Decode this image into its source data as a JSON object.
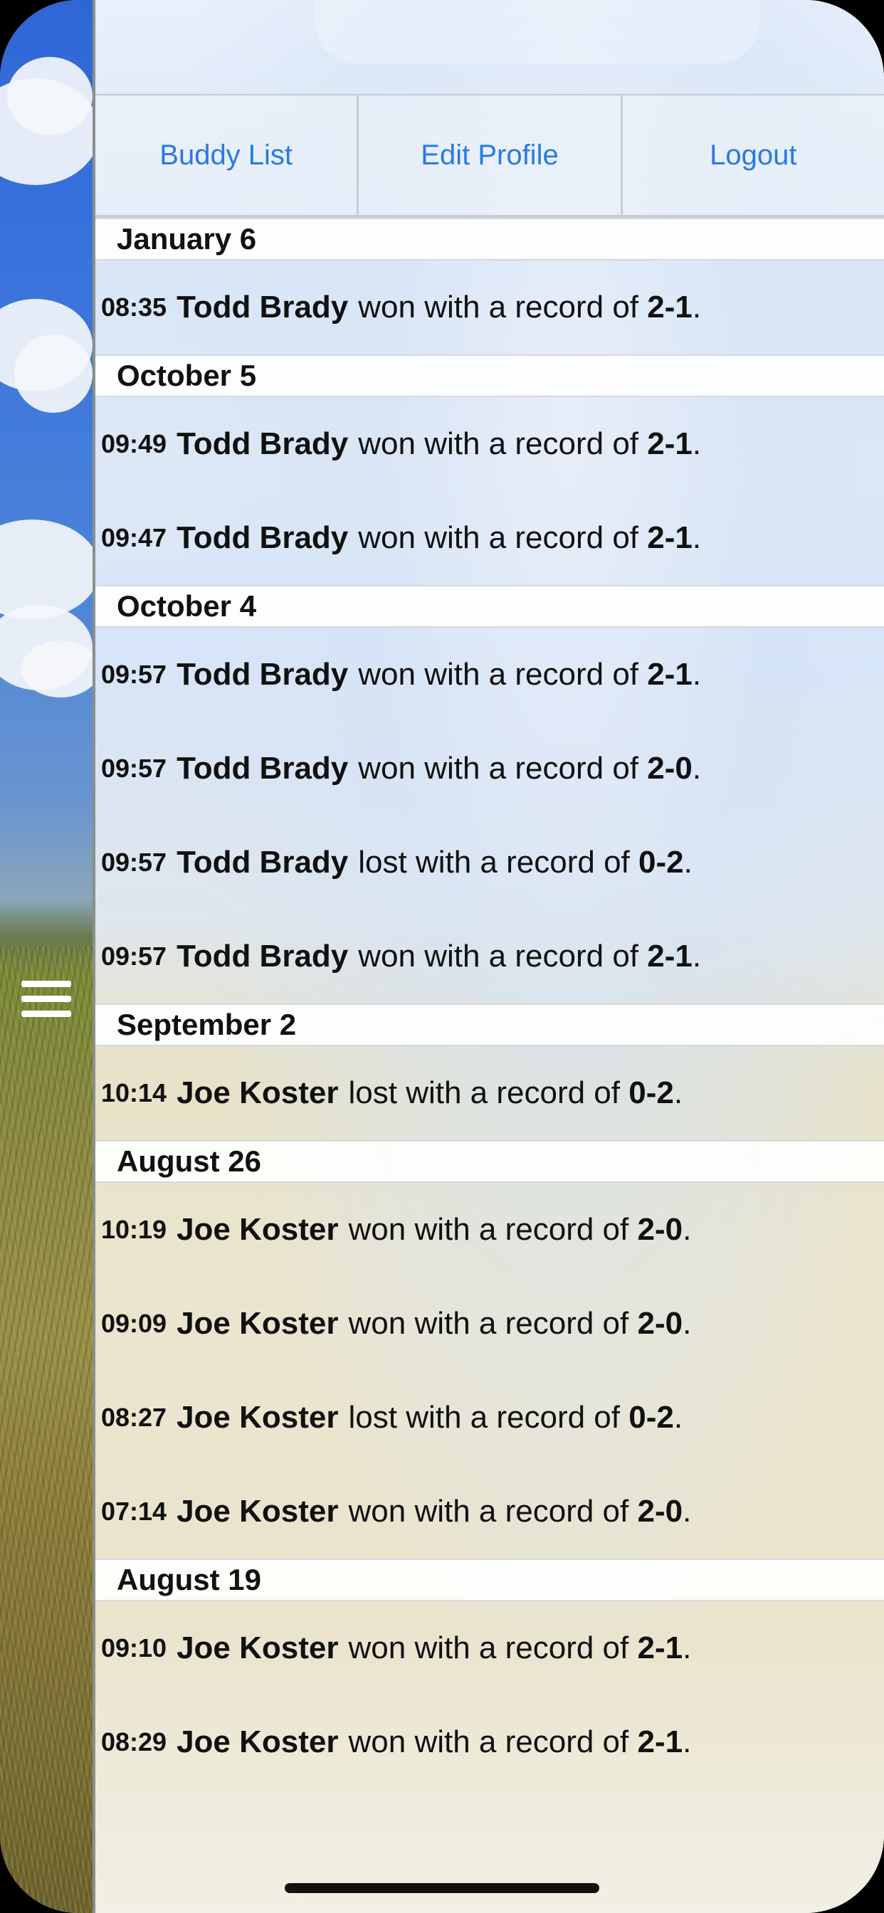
{
  "nav": {
    "buddy_list": "Buddy List",
    "edit_profile": "Edit Profile",
    "logout": "Logout"
  },
  "feed": [
    {
      "date": "January 6",
      "entries": [
        {
          "time": "08:35",
          "name": "Todd Brady",
          "verb": "won with a record of",
          "record": "2-1"
        }
      ]
    },
    {
      "date": "October 5",
      "entries": [
        {
          "time": "09:49",
          "name": "Todd Brady",
          "verb": "won with a record of",
          "record": "2-1"
        },
        {
          "time": "09:47",
          "name": "Todd Brady",
          "verb": "won with a record of",
          "record": "2-1"
        }
      ]
    },
    {
      "date": "October 4",
      "entries": [
        {
          "time": "09:57",
          "name": "Todd Brady",
          "verb": "won with a record of",
          "record": "2-1"
        },
        {
          "time": "09:57",
          "name": "Todd Brady",
          "verb": "won with a record of",
          "record": "2-0"
        },
        {
          "time": "09:57",
          "name": "Todd Brady",
          "verb": "lost with a record of",
          "record": "0-2"
        },
        {
          "time": "09:57",
          "name": "Todd Brady",
          "verb": "won with a record of",
          "record": "2-1"
        }
      ]
    },
    {
      "date": "September 2",
      "entries": [
        {
          "time": "10:14",
          "name": "Joe Koster",
          "verb": "lost with a record of",
          "record": "0-2"
        }
      ]
    },
    {
      "date": "August 26",
      "entries": [
        {
          "time": "10:19",
          "name": "Joe Koster",
          "verb": "won with a record of",
          "record": "2-0"
        },
        {
          "time": "09:09",
          "name": "Joe Koster",
          "verb": "won with a record of",
          "record": "2-0"
        },
        {
          "time": "08:27",
          "name": "Joe Koster",
          "verb": "lost with a record of",
          "record": "0-2"
        },
        {
          "time": "07:14",
          "name": "Joe Koster",
          "verb": "won with a record of",
          "record": "2-0"
        }
      ]
    },
    {
      "date": "August 19",
      "entries": [
        {
          "time": "09:10",
          "name": "Joe Koster",
          "verb": "won with a record of",
          "record": "2-1"
        },
        {
          "time": "08:29",
          "name": "Joe Koster",
          "verb": "won with a record of",
          "record": "2-1"
        }
      ]
    }
  ],
  "icons": {
    "menu": "hamburger-menu-icon"
  }
}
